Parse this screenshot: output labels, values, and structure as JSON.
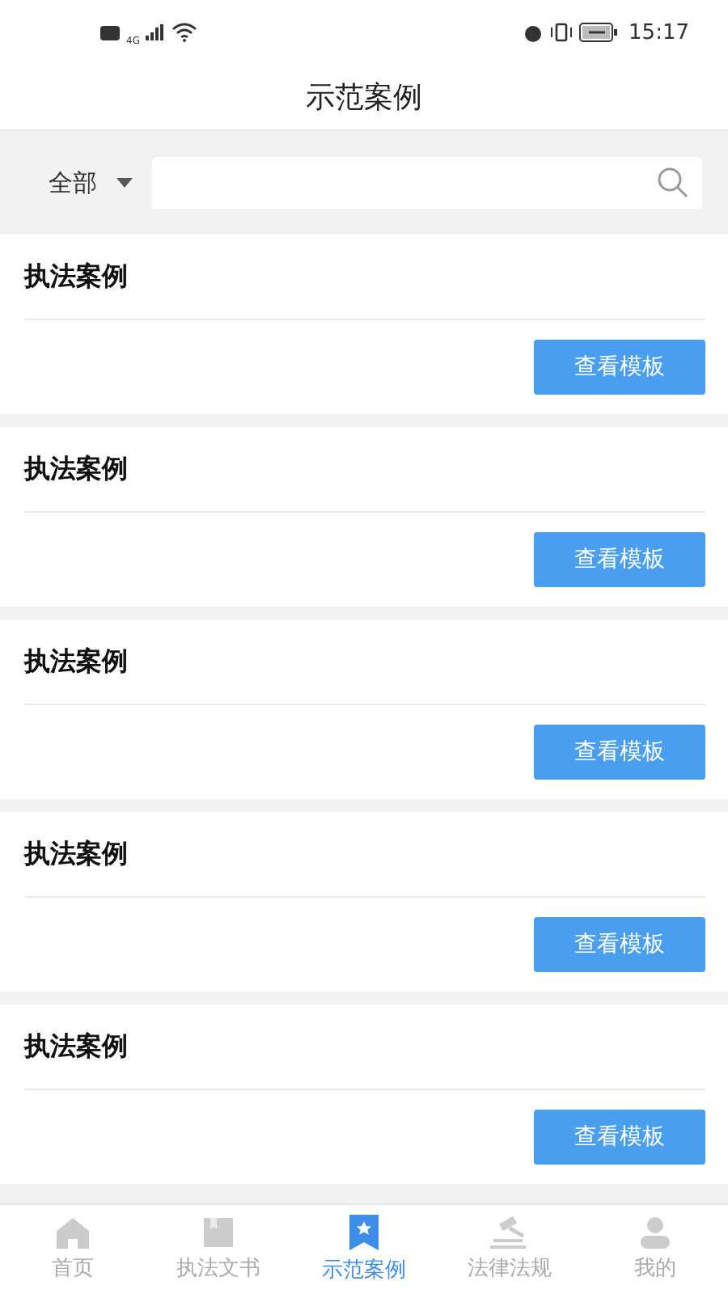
{
  "status_bar": {
    "network": "4G",
    "time": "15:17"
  },
  "title": "示范案例",
  "filter": {
    "dropdown": "全部"
  },
  "cases": [
    {
      "title": "执法案例",
      "button": "查看模板"
    },
    {
      "title": "执法案例",
      "button": "查看模板"
    },
    {
      "title": "执法案例",
      "button": "查看模板"
    },
    {
      "title": "执法案例",
      "button": "查看模板"
    },
    {
      "title": "执法案例",
      "button": "查看模板"
    }
  ],
  "tabs": [
    {
      "kind": "home",
      "label": "首页",
      "selected": false
    },
    {
      "kind": "book",
      "label": "执法文书",
      "selected": false
    },
    {
      "kind": "case",
      "label": "示范案例",
      "selected": true
    },
    {
      "kind": "law",
      "label": "法律法规",
      "selected": false
    },
    {
      "kind": "user",
      "label": "我的",
      "selected": false
    }
  ]
}
